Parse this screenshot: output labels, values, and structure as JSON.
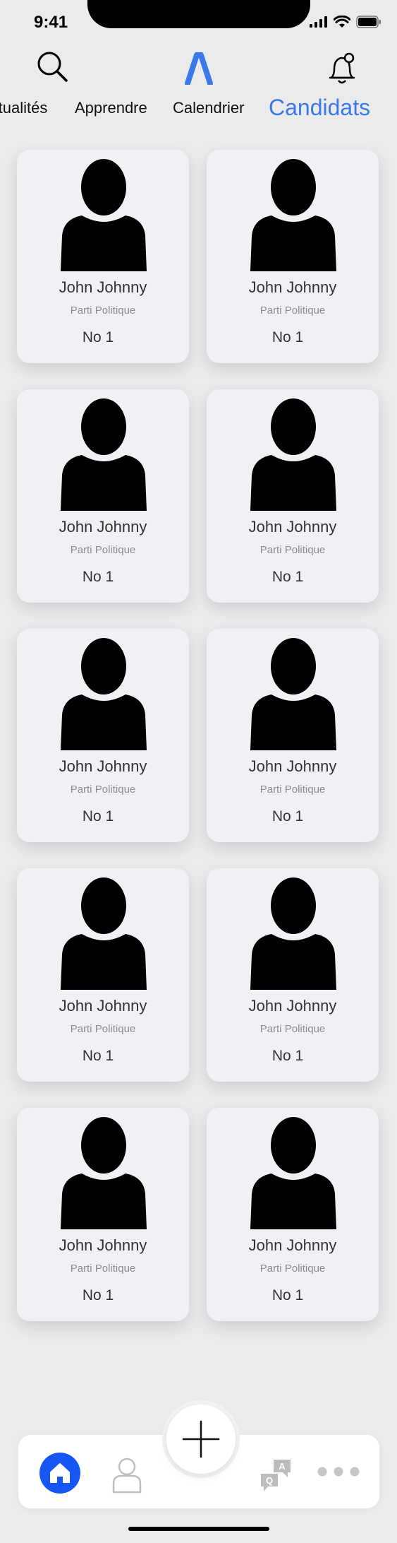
{
  "status_bar": {
    "time": "9:41"
  },
  "nav_tabs": [
    {
      "label": "Actualités",
      "active": false
    },
    {
      "label": "Apprendre",
      "active": false
    },
    {
      "label": "Calendrier",
      "active": false
    },
    {
      "label": "Candidats",
      "active": true
    }
  ],
  "candidates": [
    {
      "name": "John Johnny",
      "party": "Parti Politique",
      "number": "No 1"
    },
    {
      "name": "John Johnny",
      "party": "Parti Politique",
      "number": "No 1"
    },
    {
      "name": "John Johnny",
      "party": "Parti Politique",
      "number": "No 1"
    },
    {
      "name": "John Johnny",
      "party": "Parti Politique",
      "number": "No 1"
    },
    {
      "name": "John Johnny",
      "party": "Parti Politique",
      "number": "No 1"
    },
    {
      "name": "John Johnny",
      "party": "Parti Politique",
      "number": "No 1"
    },
    {
      "name": "John Johnny",
      "party": "Parti Politique",
      "number": "No 1"
    },
    {
      "name": "John Johnny",
      "party": "Parti Politique",
      "number": "No 1"
    },
    {
      "name": "John Johnny",
      "party": "Parti Politique",
      "number": "No 1"
    },
    {
      "name": "John Johnny",
      "party": "Parti Politique",
      "number": "No 1"
    }
  ],
  "bottom_nav": {
    "items": [
      "home-icon",
      "profile-icon",
      "qa-icon",
      "more-icon"
    ],
    "qa_question_letter": "Q",
    "qa_answer_letter": "A"
  },
  "colors": {
    "accent": "#3b79ea",
    "home_button": "#1656f5",
    "card_bg": "#f1f1f5"
  }
}
